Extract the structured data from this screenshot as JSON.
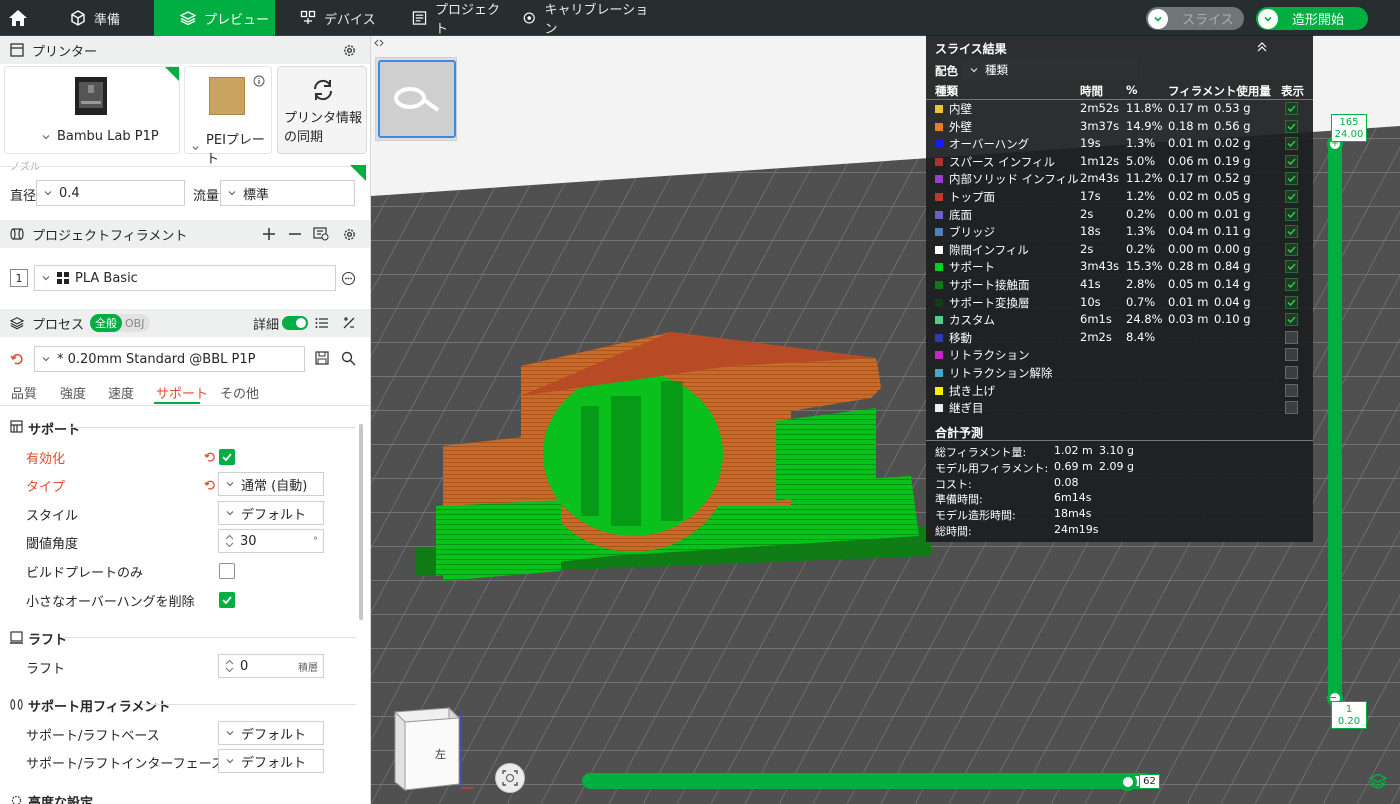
{
  "topbar": {
    "tabs": [
      {
        "label": "準備"
      },
      {
        "label": "プレビュー"
      },
      {
        "label": "デバイス"
      },
      {
        "label": "プロジェクト"
      },
      {
        "label": "キャリブレーション"
      }
    ],
    "slice_label": "スライス",
    "print_label": "造形開始"
  },
  "printer": {
    "title": "プリンター",
    "model": "Bambu Lab P1P",
    "plate": "PEIプレート",
    "sync": "プリンタ情報の同期",
    "nozzle_title": "ノズル",
    "diameter_label": "直径",
    "diameter_value": "0.4",
    "flow_label": "流量",
    "flow_value": "標準"
  },
  "filament": {
    "title": "プロジェクトフィラメント",
    "slot": "1",
    "name": "PLA Basic"
  },
  "process": {
    "title": "プロセス",
    "toggle_global": "全般",
    "toggle_obj": "OBJ",
    "detail_label": "詳細",
    "profile": "* 0.20mm Standard @BBL P1P",
    "tabs": [
      "品質",
      "強度",
      "速度",
      "サポート",
      "その他"
    ],
    "active_tab": "サポート"
  },
  "support": {
    "title": "サポート",
    "enable_label": "有効化",
    "type_label": "タイプ",
    "type_value": "通常 (自動)",
    "style_label": "スタイル",
    "style_value": "デフォルト",
    "threshold_label": "閾値角度",
    "threshold_value": "30",
    "threshold_unit": "°",
    "buildplate_label": "ビルドプレートのみ",
    "remove_small_label": "小さなオーバーハングを削除"
  },
  "raft": {
    "title": "ラフト",
    "label": "ラフト",
    "value": "0",
    "unit": "積層"
  },
  "support_filament": {
    "title": "サポート用フィラメント",
    "base_label": "サポート/ラフトベース",
    "base_value": "デフォルト",
    "interface_label": "サポート/ラフトインターフェース",
    "interface_value": "デフォルト"
  },
  "advanced": {
    "title": "高度な設定"
  },
  "slice_result": {
    "title": "スライス結果",
    "color_label": "配色",
    "color_scheme": "種類",
    "headers": {
      "type": "種類",
      "time": "時間",
      "pct": "%",
      "usage": "フィラメント使用量",
      "show": "表示"
    },
    "rows": [
      {
        "name": "内壁",
        "time": "2m52s",
        "pct": "11.8%",
        "len": "0.17 m",
        "wt": "0.53 g",
        "color": "#f1c232",
        "visible": true
      },
      {
        "name": "外壁",
        "time": "3m37s",
        "pct": "14.9%",
        "len": "0.18 m",
        "wt": "0.56 g",
        "color": "#e67e22",
        "visible": true
      },
      {
        "name": "オーバーハング",
        "time": "19s",
        "pct": "1.3%",
        "len": "0.01 m",
        "wt": "0.02 g",
        "color": "#1a1aff",
        "visible": true
      },
      {
        "name": "スパース インフィル",
        "time": "1m12s",
        "pct": "5.0%",
        "len": "0.06 m",
        "wt": "0.19 g",
        "color": "#b03029",
        "visible": true
      },
      {
        "name": "内部ソリッド インフィル",
        "time": "2m43s",
        "pct": "11.2%",
        "len": "0.17 m",
        "wt": "0.52 g",
        "color": "#9a3ccf",
        "visible": true
      },
      {
        "name": "トップ面",
        "time": "17s",
        "pct": "1.2%",
        "len": "0.02 m",
        "wt": "0.05 g",
        "color": "#c0392b",
        "visible": true
      },
      {
        "name": "底面",
        "time": "2s",
        "pct": "0.2%",
        "len": "0.00 m",
        "wt": "0.01 g",
        "color": "#6c5fc7",
        "visible": true
      },
      {
        "name": "ブリッジ",
        "time": "18s",
        "pct": "1.3%",
        "len": "0.04 m",
        "wt": "0.11 g",
        "color": "#4e7fbf",
        "visible": true
      },
      {
        "name": "隙間インフィル",
        "time": "2s",
        "pct": "0.2%",
        "len": "0.00 m",
        "wt": "0.00 g",
        "color": "#ffffff",
        "visible": true
      },
      {
        "name": "サポート",
        "time": "3m43s",
        "pct": "15.3%",
        "len": "0.28 m",
        "wt": "0.84 g",
        "color": "#00d11c",
        "visible": true
      },
      {
        "name": "サポート接触面",
        "time": "41s",
        "pct": "2.8%",
        "len": "0.05 m",
        "wt": "0.14 g",
        "color": "#0d7a1a",
        "visible": true
      },
      {
        "name": "サポート変換層",
        "time": "10s",
        "pct": "0.7%",
        "len": "0.01 m",
        "wt": "0.04 g",
        "color": "#123d16",
        "visible": true
      },
      {
        "name": "カスタム",
        "time": "6m1s",
        "pct": "24.8%",
        "len": "0.03 m",
        "wt": "0.10 g",
        "color": "#4fce8a",
        "visible": true
      },
      {
        "name": "移動",
        "time": "2m2s",
        "pct": "8.4%",
        "len": "",
        "wt": "",
        "color": "#2a3ab8",
        "visible": false
      },
      {
        "name": "リトラクション",
        "time": "",
        "pct": "",
        "len": "",
        "wt": "",
        "color": "#cc22cc",
        "visible": false
      },
      {
        "name": "リトラクション解除",
        "time": "",
        "pct": "",
        "len": "",
        "wt": "",
        "color": "#46a6c7",
        "visible": false
      },
      {
        "name": "拭き上げ",
        "time": "",
        "pct": "",
        "len": "",
        "wt": "",
        "color": "#ffee00",
        "visible": false
      },
      {
        "name": "継ぎ目",
        "time": "",
        "pct": "",
        "len": "",
        "wt": "",
        "color": "#eeeeee",
        "visible": false
      }
    ],
    "totals_title": "合計予測",
    "totals": [
      {
        "label": "総フィラメント量:",
        "v1": "1.02 m",
        "v2": "3.10 g"
      },
      {
        "label": "モデル用フィラメント:",
        "v1": "0.69 m",
        "v2": "2.09 g"
      },
      {
        "label": "コスト:",
        "v1": "0.08",
        "v2": ""
      },
      {
        "label": "準備時間:",
        "v1": "6m14s",
        "v2": ""
      },
      {
        "label": "モデル造形時間:",
        "v1": "18m4s",
        "v2": ""
      },
      {
        "label": "総時間:",
        "v1": "24m19s",
        "v2": ""
      }
    ]
  },
  "layer_slider": {
    "top_layer": "165",
    "top_height": "24.00",
    "bottom_layer": "1",
    "bottom_height": "0.20"
  },
  "move_slider": {
    "value": "62",
    "fraction": 0.97
  },
  "view_cube": {
    "label": "左"
  },
  "colors": {
    "accent": "#00ae42",
    "topbar": "#262e30",
    "support_green": "#00d11c",
    "wall_orange": "#e67e22"
  }
}
